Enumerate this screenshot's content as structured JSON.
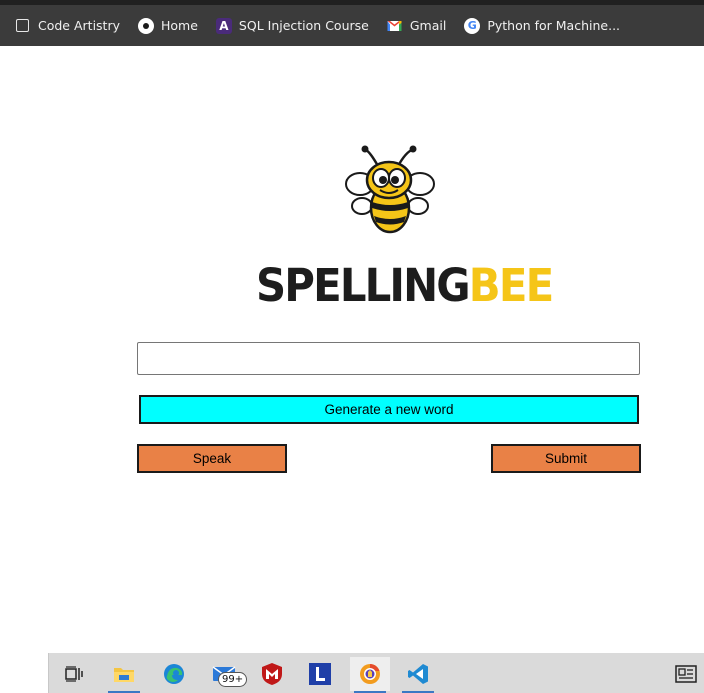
{
  "bookmarks": [
    {
      "label": "Code Artistry",
      "icon": "checkbox-icon"
    },
    {
      "label": "Home",
      "icon": "circle-dot-icon"
    },
    {
      "label": "SQL Injection Course",
      "icon": "letter-a-icon"
    },
    {
      "label": "Gmail",
      "icon": "gmail-icon"
    },
    {
      "label": "Python for Machine...",
      "icon": "google-icon"
    }
  ],
  "logo": {
    "word_dark": "SPELLING",
    "word_accent": "BEE"
  },
  "word_input": {
    "value": "",
    "placeholder": ""
  },
  "buttons": {
    "generate": "Generate a new word",
    "speak": "Speak",
    "submit": "Submit"
  },
  "taskbar": {
    "mail_badge": "99+",
    "icons": [
      "task-view-icon",
      "file-explorer-icon",
      "edge-icon",
      "mail-icon",
      "mcafee-icon",
      "launcher-l-icon",
      "chrome-canary-icon",
      "vscode-icon",
      "news-widget-icon"
    ]
  },
  "colors": {
    "generate_button": "#00ffff",
    "action_buttons": "#e98146",
    "bee_yellow": "#f5c518",
    "bookmark_bar": "#3b3b3b"
  }
}
